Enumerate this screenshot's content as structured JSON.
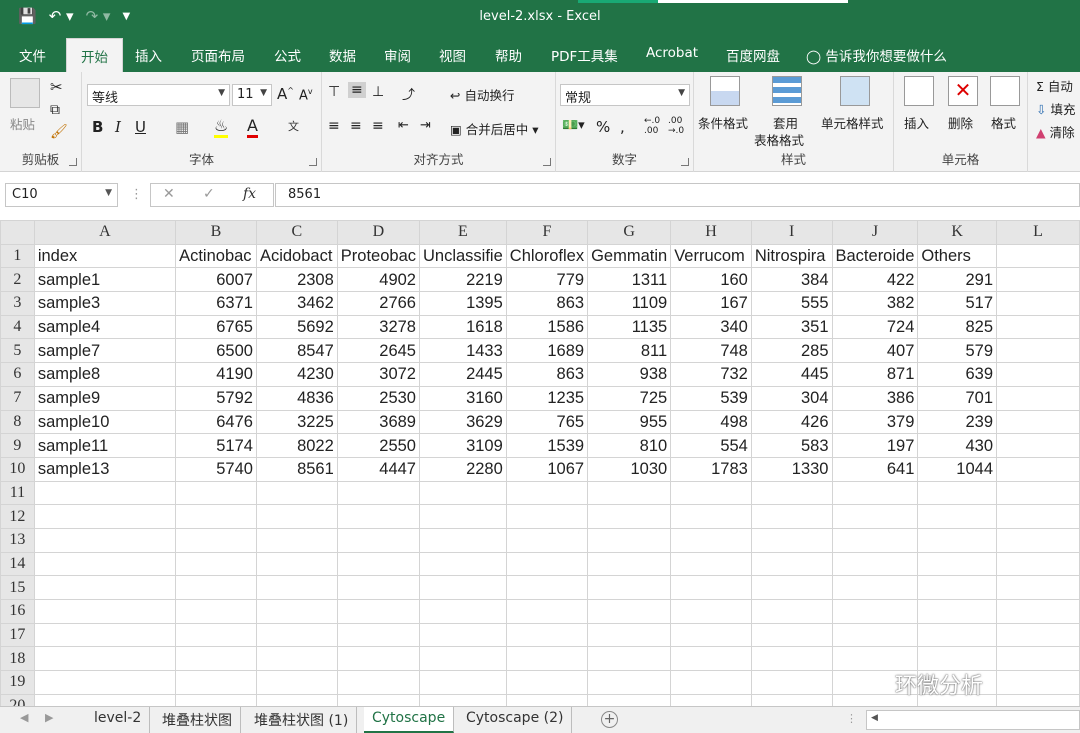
{
  "titlebar": {
    "title": "level-2.xlsx  -  Excel"
  },
  "tabs": [
    "文件",
    "开始",
    "插入",
    "页面布局",
    "公式",
    "数据",
    "审阅",
    "视图",
    "帮助",
    "PDF工具集",
    "Acrobat",
    "百度网盘",
    "告诉我你想要做什么"
  ],
  "ribbon": {
    "clipboard": {
      "paste": "粘贴",
      "group": "剪贴板"
    },
    "font": {
      "name": "等线",
      "size": "11",
      "group": "字体",
      "bold": "B",
      "italic": "I",
      "underline": "U"
    },
    "align": {
      "wrap": "自动换行",
      "merge": "合并后居中",
      "group": "对齐方式"
    },
    "number": {
      "format": "常规",
      "group": "数字"
    },
    "styles": {
      "conditional": "条件格式",
      "table_format_1": "套用",
      "table_format_2": "表格格式",
      "cell_styles": "单元格样式",
      "group": "样式"
    },
    "cells": {
      "insert": "插入",
      "delete": "删除",
      "format": "格式",
      "group": "单元格"
    },
    "editing": {
      "autosum": "自动",
      "fill": "填充",
      "clear": "清除"
    }
  },
  "formula_bar": {
    "name_box": "C10",
    "fx": "fx",
    "formula": "8561"
  },
  "sheet": {
    "columns": [
      "A",
      "B",
      "C",
      "D",
      "E",
      "F",
      "G",
      "H",
      "I",
      "J",
      "K",
      "L"
    ],
    "rows": [
      [
        "index",
        "Actinobac",
        "Acidobact",
        "Proteobac",
        "Unclassifie",
        "Chloroflex",
        "Gemmatin",
        "Verrucom",
        "Nitrospira",
        "Bacteroide",
        "Others",
        ""
      ],
      [
        "sample1",
        "6007",
        "2308",
        "4902",
        "2219",
        "779",
        "1311",
        "160",
        "384",
        "422",
        "291",
        ""
      ],
      [
        "sample3",
        "6371",
        "3462",
        "2766",
        "1395",
        "863",
        "1109",
        "167",
        "555",
        "382",
        "517",
        ""
      ],
      [
        "sample4",
        "6765",
        "5692",
        "3278",
        "1618",
        "1586",
        "1135",
        "340",
        "351",
        "724",
        "825",
        ""
      ],
      [
        "sample7",
        "6500",
        "8547",
        "2645",
        "1433",
        "1689",
        "811",
        "748",
        "285",
        "407",
        "579",
        ""
      ],
      [
        "sample8",
        "4190",
        "4230",
        "3072",
        "2445",
        "863",
        "938",
        "732",
        "445",
        "871",
        "639",
        ""
      ],
      [
        "sample9",
        "5792",
        "4836",
        "2530",
        "3160",
        "1235",
        "725",
        "539",
        "304",
        "386",
        "701",
        ""
      ],
      [
        "sample10",
        "6476",
        "3225",
        "3689",
        "3629",
        "765",
        "955",
        "498",
        "426",
        "379",
        "239",
        ""
      ],
      [
        "sample11",
        "5174",
        "8022",
        "2550",
        "3109",
        "1539",
        "810",
        "554",
        "583",
        "197",
        "430",
        ""
      ],
      [
        "sample13",
        "5740",
        "8561",
        "4447",
        "2280",
        "1067",
        "1030",
        "1783",
        "1330",
        "641",
        "1044",
        ""
      ],
      [
        "",
        "",
        "",
        "",
        "",
        "",
        "",
        "",
        "",
        "",
        "",
        ""
      ],
      [
        "",
        "",
        "",
        "",
        "",
        "",
        "",
        "",
        "",
        "",
        "",
        ""
      ],
      [
        "",
        "",
        "",
        "",
        "",
        "",
        "",
        "",
        "",
        "",
        "",
        ""
      ],
      [
        "",
        "",
        "",
        "",
        "",
        "",
        "",
        "",
        "",
        "",
        "",
        ""
      ],
      [
        "",
        "",
        "",
        "",
        "",
        "",
        "",
        "",
        "",
        "",
        "",
        ""
      ],
      [
        "",
        "",
        "",
        "",
        "",
        "",
        "",
        "",
        "",
        "",
        "",
        ""
      ],
      [
        "",
        "",
        "",
        "",
        "",
        "",
        "",
        "",
        "",
        "",
        "",
        ""
      ],
      [
        "",
        "",
        "",
        "",
        "",
        "",
        "",
        "",
        "",
        "",
        "",
        ""
      ],
      [
        "",
        "",
        "",
        "",
        "",
        "",
        "",
        "",
        "",
        "",
        "",
        ""
      ],
      [
        "",
        "",
        "",
        "",
        "",
        "",
        "",
        "",
        "",
        "",
        "",
        ""
      ]
    ]
  },
  "sheet_tabs": [
    "level-2",
    "堆叠柱状图",
    "堆叠柱状图 (1)",
    "Cytoscape",
    "Cytoscape (2)"
  ],
  "active_sheet": "Cytoscape",
  "watermark": "环微分析",
  "colors": {
    "brand": "#217346",
    "accent": "#19a974"
  }
}
